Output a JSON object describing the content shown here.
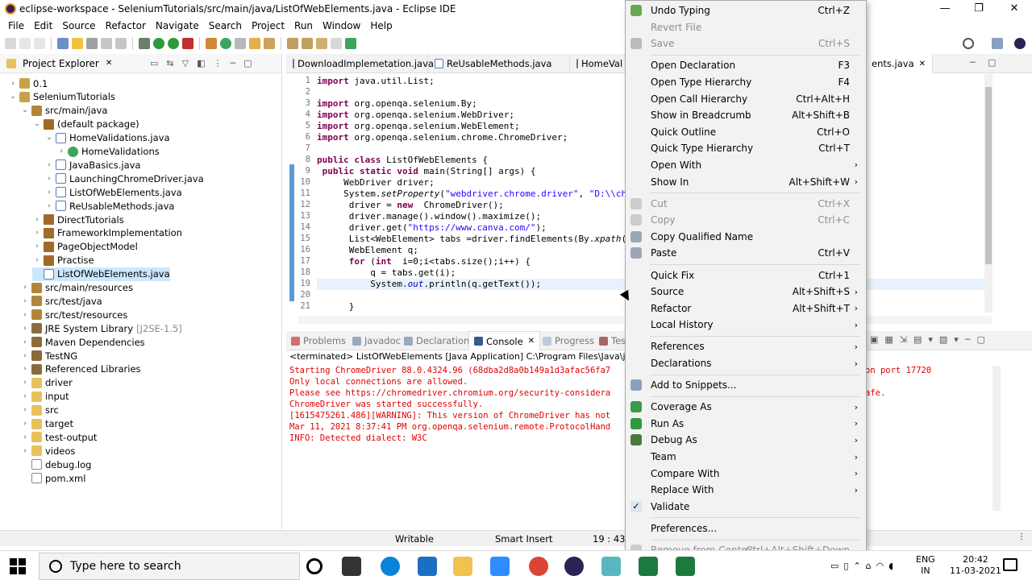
{
  "window": {
    "title": "eclipse-workspace - SeleniumTutorials/src/main/java/ListOfWebElements.java - Eclipse IDE",
    "minimize": "—",
    "maximize": "❐",
    "close": "✕"
  },
  "menubar": [
    "File",
    "Edit",
    "Source",
    "Refactor",
    "Navigate",
    "Search",
    "Project",
    "Run",
    "Window",
    "Help"
  ],
  "project_explorer": {
    "title": "Project Explorer",
    "items": [
      {
        "label": "0.1",
        "depth": 0,
        "twisty": "›",
        "icon": "proj"
      },
      {
        "label": "SeleniumTutorials",
        "depth": 0,
        "twisty": "⌄",
        "icon": "proj"
      },
      {
        "label": "src/main/java",
        "depth": 1,
        "twisty": "⌄",
        "icon": "src"
      },
      {
        "label": "(default package)",
        "depth": 2,
        "twisty": "⌄",
        "icon": "pkg"
      },
      {
        "label": "HomeValidations.java",
        "depth": 3,
        "twisty": "⌄",
        "icon": "java"
      },
      {
        "label": "HomeValidations",
        "depth": 4,
        "twisty": "›",
        "icon": "cls"
      },
      {
        "label": "JavaBasics.java",
        "depth": 3,
        "twisty": "›",
        "icon": "java"
      },
      {
        "label": "LaunchingChromeDriver.java",
        "depth": 3,
        "twisty": "›",
        "icon": "java"
      },
      {
        "label": "ListOfWebElements.java",
        "depth": 3,
        "twisty": "›",
        "icon": "java"
      },
      {
        "label": "ReUsableMethods.java",
        "depth": 3,
        "twisty": "›",
        "icon": "java"
      },
      {
        "label": "DirectTutorials",
        "depth": 2,
        "twisty": "›",
        "icon": "pkg"
      },
      {
        "label": "FrameworkImplementation",
        "depth": 2,
        "twisty": "›",
        "icon": "pkg"
      },
      {
        "label": "PageObjectModel",
        "depth": 2,
        "twisty": "›",
        "icon": "pkg"
      },
      {
        "label": "Practise",
        "depth": 2,
        "twisty": "›",
        "icon": "pkg"
      },
      {
        "label": "ListOfWebElements.java",
        "depth": 2,
        "twisty": "",
        "icon": "java",
        "selected": true
      },
      {
        "label": "src/main/resources",
        "depth": 1,
        "twisty": "›",
        "icon": "src"
      },
      {
        "label": "src/test/java",
        "depth": 1,
        "twisty": "›",
        "icon": "src"
      },
      {
        "label": "src/test/resources",
        "depth": 1,
        "twisty": "›",
        "icon": "src"
      },
      {
        "label": "JRE System Library",
        "sub": "[J2SE-1.5]",
        "depth": 1,
        "twisty": "›",
        "icon": "lib"
      },
      {
        "label": "Maven Dependencies",
        "depth": 1,
        "twisty": "›",
        "icon": "lib"
      },
      {
        "label": "TestNG",
        "depth": 1,
        "twisty": "›",
        "icon": "lib"
      },
      {
        "label": "Referenced Libraries",
        "depth": 1,
        "twisty": "›",
        "icon": "lib"
      },
      {
        "label": "driver",
        "depth": 1,
        "twisty": "›",
        "icon": "folder"
      },
      {
        "label": "input",
        "depth": 1,
        "twisty": "›",
        "icon": "folder"
      },
      {
        "label": "src",
        "depth": 1,
        "twisty": "›",
        "icon": "folder"
      },
      {
        "label": "target",
        "depth": 1,
        "twisty": "›",
        "icon": "folder"
      },
      {
        "label": "test-output",
        "depth": 1,
        "twisty": "›",
        "icon": "folder"
      },
      {
        "label": "videos",
        "depth": 1,
        "twisty": "›",
        "icon": "folder"
      },
      {
        "label": "debug.log",
        "depth": 1,
        "twisty": "",
        "icon": "file"
      },
      {
        "label": "pom.xml",
        "depth": 1,
        "twisty": "",
        "icon": "file"
      }
    ]
  },
  "editor_tabs": [
    "DownloadImplemetation.java",
    "ReUsableMethods.java",
    "HomeVal",
    "ents.java"
  ],
  "editor_lines": [
    {
      "n": "1",
      "prefix": "⊕",
      "parts": [
        [
          "kw",
          "import"
        ],
        [
          "",
          "java.util.List;"
        ]
      ]
    },
    {
      "n": "2",
      "parts": []
    },
    {
      "n": "3",
      "parts": [
        [
          "kw",
          "import"
        ],
        [
          "",
          "org.openqa.selenium.By;"
        ]
      ]
    },
    {
      "n": "4",
      "parts": [
        [
          "kw",
          "import"
        ],
        [
          "",
          "org.openqa.selenium.WebDriver;"
        ]
      ]
    },
    {
      "n": "5",
      "parts": [
        [
          "kw",
          "import"
        ],
        [
          "",
          "org.openqa.selenium.WebElement;"
        ]
      ]
    },
    {
      "n": "6",
      "parts": [
        [
          "kw",
          "import"
        ],
        [
          "",
          "org.openqa.selenium.chrome.ChromeDriver;"
        ]
      ]
    },
    {
      "n": "7",
      "parts": []
    },
    {
      "n": "8",
      "parts": [
        [
          "kw",
          "public class"
        ],
        [
          "",
          "ListOfWebElements {"
        ]
      ]
    },
    {
      "n": "9",
      "prefix": "⊖",
      "parts": [
        [
          "kw",
          " public static void"
        ],
        [
          "",
          "main(String[] args) {"
        ]
      ]
    },
    {
      "n": "10",
      "parts": [
        [
          "",
          "     WebDriver driver;"
        ]
      ]
    },
    {
      "n": "11",
      "parts": [
        [
          "",
          "     System."
        ],
        [
          "it",
          "setProperty"
        ],
        [
          "",
          "("
        ],
        [
          "str",
          "\"webdriver.chrome.driver\""
        ],
        [
          "",
          ", "
        ],
        [
          "str",
          "\"D:\\\\ch"
        ]
      ]
    },
    {
      "n": "12",
      "parts": [
        [
          "",
          "      driver = "
        ],
        [
          "kw",
          "new"
        ],
        [
          "",
          " ChromeDriver();"
        ]
      ]
    },
    {
      "n": "13",
      "parts": [
        [
          "",
          "      driver.manage().window().maximize();"
        ]
      ]
    },
    {
      "n": "14",
      "parts": [
        [
          "",
          "      driver.get("
        ],
        [
          "str",
          "\"https://www.canva.com/\""
        ],
        [
          "",
          ");"
        ]
      ]
    },
    {
      "n": "15",
      "parts": [
        [
          "",
          "      List<WebElement> tabs =driver.findElements(By."
        ],
        [
          "it",
          "xpath"
        ],
        [
          "",
          "("
        ]
      ]
    },
    {
      "n": "16",
      "parts": [
        [
          "",
          "      WebElement q;"
        ]
      ]
    },
    {
      "n": "17",
      "parts": [
        [
          "",
          "      "
        ],
        [
          "kw",
          "for"
        ],
        [
          "",
          "("
        ],
        [
          "kw",
          "int"
        ],
        [
          "",
          " i=0;i<tabs.size();i++) {"
        ]
      ]
    },
    {
      "n": "18",
      "parts": [
        [
          "",
          "          q = tabs.get(i);"
        ]
      ]
    },
    {
      "n": "19",
      "parts": [
        [
          "",
          "          System."
        ],
        [
          "fld",
          "out"
        ],
        [
          "",
          ".println(q.getText());"
        ]
      ]
    },
    {
      "n": "20",
      "parts": []
    },
    {
      "n": "21",
      "parts": [
        [
          "",
          "      }"
        ]
      ]
    }
  ],
  "console_tabs": [
    {
      "label": "Problems",
      "active": false
    },
    {
      "label": "Javadoc",
      "active": false
    },
    {
      "label": "Declaration",
      "active": false
    },
    {
      "label": "Console",
      "active": true
    },
    {
      "label": "Progress",
      "active": false
    },
    {
      "label": "Tes",
      "active": false
    }
  ],
  "console": {
    "terminated": "<terminated> ListOfWebElements [Java Application] C:\\Program Files\\Java\\jdk1.8.0_",
    "lines": [
      "Starting ChromeDriver 88.0.4324.96 (68dba2d8a0b149a1d3afac56fa7",
      "Only local connections are allowed.",
      "Please see https://chromedriver.chromium.org/security-considera",
      "ChromeDriver was started successfully.",
      "[1615475261.486][WARNING]: This version of ChromeDriver has not",
      "Mar 11, 2021 8:37:41 PM org.openqa.selenium.remote.ProtocolHand",
      "INFO: Detected dialect: W3C"
    ],
    "right_fragments": [
      "on port 17720",
      "afe."
    ]
  },
  "statusbar": {
    "writable": "Writable",
    "insert": "Smart Insert",
    "position": "19 : 43 :"
  },
  "context_menu": [
    {
      "label": "Undo Typing",
      "key": "Ctrl+Z",
      "icon": "#6aa84f"
    },
    {
      "label": "Revert File",
      "disabled": true
    },
    {
      "label": "Save",
      "key": "Ctrl+S",
      "disabled": true,
      "icon": "#bbbbbb"
    },
    {
      "sep": true
    },
    {
      "label": "Open Declaration",
      "key": "F3"
    },
    {
      "label": "Open Type Hierarchy",
      "key": "F4"
    },
    {
      "label": "Open Call Hierarchy",
      "key": "Ctrl+Alt+H"
    },
    {
      "label": "Show in Breadcrumb",
      "key": "Alt+Shift+B"
    },
    {
      "label": "Quick Outline",
      "key": "Ctrl+O"
    },
    {
      "label": "Quick Type Hierarchy",
      "key": "Ctrl+T"
    },
    {
      "label": "Open With",
      "submenu": true
    },
    {
      "label": "Show In",
      "key": "Alt+Shift+W",
      "submenu": true
    },
    {
      "sep": true
    },
    {
      "label": "Cut",
      "key": "Ctrl+X",
      "disabled": true,
      "icon": "#cccccc"
    },
    {
      "label": "Copy",
      "key": "Ctrl+C",
      "disabled": true,
      "icon": "#cccccc"
    },
    {
      "label": "Copy Qualified Name",
      "icon": "#9aa7b8"
    },
    {
      "label": "Paste",
      "key": "Ctrl+V",
      "icon": "#9aa7b8"
    },
    {
      "sep": true
    },
    {
      "label": "Quick Fix",
      "key": "Ctrl+1"
    },
    {
      "label": "Source",
      "key": "Alt+Shift+S",
      "submenu": true
    },
    {
      "label": "Refactor",
      "key": "Alt+Shift+T",
      "submenu": true
    },
    {
      "label": "Local History",
      "submenu": true
    },
    {
      "sep": true
    },
    {
      "label": "References",
      "submenu": true
    },
    {
      "label": "Declarations",
      "submenu": true
    },
    {
      "sep": true
    },
    {
      "label": "Add to Snippets...",
      "icon": "#8aa0c0"
    },
    {
      "sep": true
    },
    {
      "label": "Coverage As",
      "submenu": true,
      "icon": "#3d9a4a"
    },
    {
      "label": "Run As",
      "submenu": true,
      "icon": "#2e9b3b"
    },
    {
      "label": "Debug As",
      "submenu": true,
      "icon": "#4a7a3a"
    },
    {
      "label": "Team",
      "submenu": true
    },
    {
      "label": "Compare With",
      "submenu": true
    },
    {
      "label": "Replace With",
      "submenu": true
    },
    {
      "label": "Validate",
      "check": "✓"
    },
    {
      "sep": true
    },
    {
      "label": "Preferences..."
    },
    {
      "sep": true
    },
    {
      "label": "Remove from Context",
      "key": "Ctrl+Alt+Shift+Down",
      "disabled": true,
      "icon": "#cccccc"
    }
  ],
  "taskbar": {
    "search_placeholder": "Type here to search",
    "lang1": "ENG",
    "lang2": "IN",
    "time": "20:42",
    "date": "11-03-2021",
    "apps": [
      {
        "name": "cortana",
        "color": "#000000"
      },
      {
        "name": "task-view",
        "color": "#333333"
      },
      {
        "name": "edge",
        "color": "#0a84d8"
      },
      {
        "name": "mail",
        "color": "#1a6fc2"
      },
      {
        "name": "file-explorer",
        "color": "#f2c14e"
      },
      {
        "name": "zoom",
        "color": "#2d8cff"
      },
      {
        "name": "chrome",
        "color": "#db4437"
      },
      {
        "name": "eclipse",
        "color": "#2c2255"
      },
      {
        "name": "app-teal",
        "color": "#5ab7c0"
      },
      {
        "name": "excel-1",
        "color": "#1d7a3f"
      },
      {
        "name": "excel-2",
        "color": "#1d7a3f"
      }
    ]
  },
  "colors": {
    "console_error": "#e00000",
    "keyword": "#7f0055",
    "string": "#2a00ff",
    "selection": "#cce8ff"
  }
}
